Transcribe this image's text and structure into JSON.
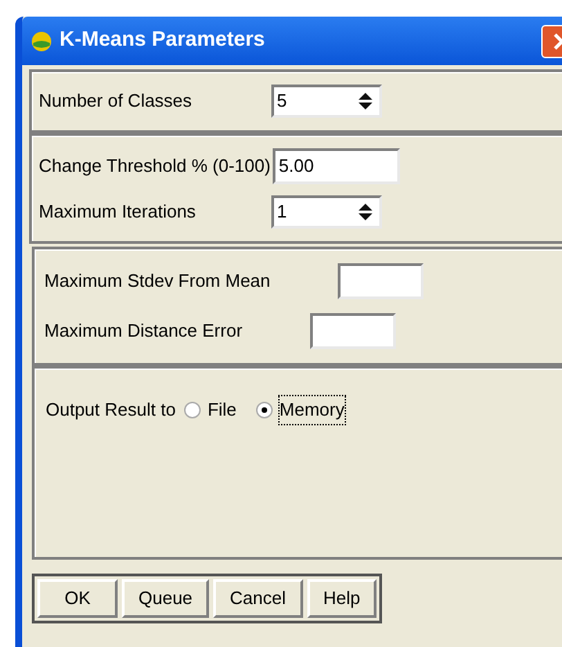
{
  "window": {
    "title": "K-Means Parameters"
  },
  "sections": [
    {
      "fields": [
        {
          "label": "Number of Classes",
          "kind": "spin",
          "value": "5"
        }
      ]
    },
    {
      "fields": [
        {
          "label": "Change Threshold % (0-100)",
          "kind": "text",
          "value": "5.00"
        },
        {
          "label": "Maximum Iterations",
          "kind": "spin",
          "value": "1"
        }
      ]
    },
    {
      "fields": [
        {
          "label": "Maximum Stdev From Mean",
          "kind": "text"
        },
        {
          "label": "Maximum Distance Error",
          "kind": "text"
        }
      ]
    }
  ],
  "output": {
    "label": "Output Result to",
    "options": [
      {
        "label": "File",
        "selected": false,
        "focused": false
      },
      {
        "label": "Memory",
        "selected": true,
        "focused": true
      }
    ]
  },
  "buttons": [
    "OK",
    "Queue",
    "Cancel",
    "Help"
  ]
}
